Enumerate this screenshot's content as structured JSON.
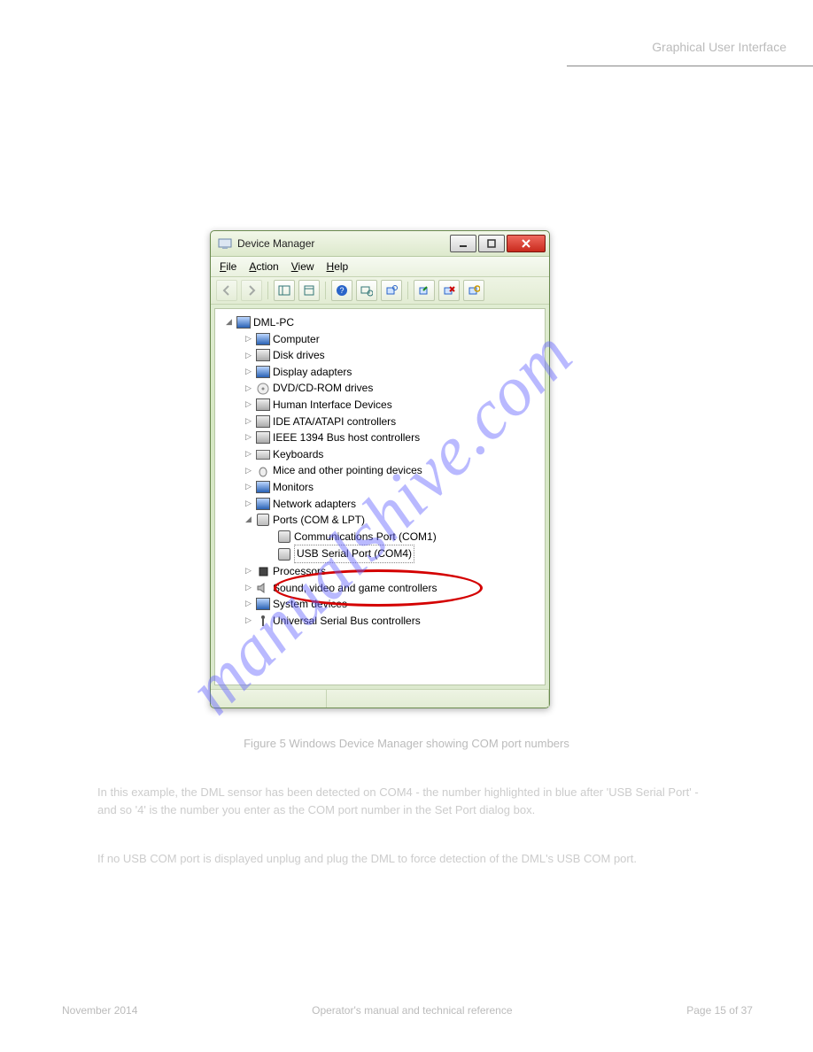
{
  "doc": {
    "header_title": "Graphical User Interface",
    "figure_caption": "Figure 5 Windows Device Manager showing COM port numbers",
    "body1": "In this example, the DML sensor has been detected on COM4 - the number highlighted in blue after 'USB Serial Port' - and so '4' is the number you enter as the COM port number in the Set Port dialog box.",
    "body2": "If no USB COM port is displayed unplug and plug the DML to force detection of the DML's USB COM port.",
    "footer_left": "November 2014",
    "footer_center": "Operator's manual and technical reference",
    "footer_right": "Page 15 of 37"
  },
  "watermark": "manualshive.com",
  "window": {
    "title": "Device Manager",
    "menus": [
      "File",
      "Action",
      "View",
      "Help"
    ],
    "root": "DML-PC",
    "categories": [
      {
        "label": "Computer"
      },
      {
        "label": "Disk drives"
      },
      {
        "label": "Display adapters"
      },
      {
        "label": "DVD/CD-ROM drives"
      },
      {
        "label": "Human Interface Devices"
      },
      {
        "label": "IDE ATA/ATAPI controllers"
      },
      {
        "label": "IEEE 1394 Bus host controllers"
      },
      {
        "label": "Keyboards"
      },
      {
        "label": "Mice and other pointing devices"
      },
      {
        "label": "Monitors"
      },
      {
        "label": "Network adapters"
      },
      {
        "label": "Ports (COM & LPT)",
        "expanded": true,
        "children": [
          {
            "label": "Communications Port (COM1)"
          },
          {
            "label": "USB Serial Port (COM4)",
            "selected": true
          }
        ]
      },
      {
        "label": "Processors"
      },
      {
        "label": "Sound, video and game controllers"
      },
      {
        "label": "System devices"
      },
      {
        "label": "Universal Serial Bus controllers"
      }
    ]
  }
}
